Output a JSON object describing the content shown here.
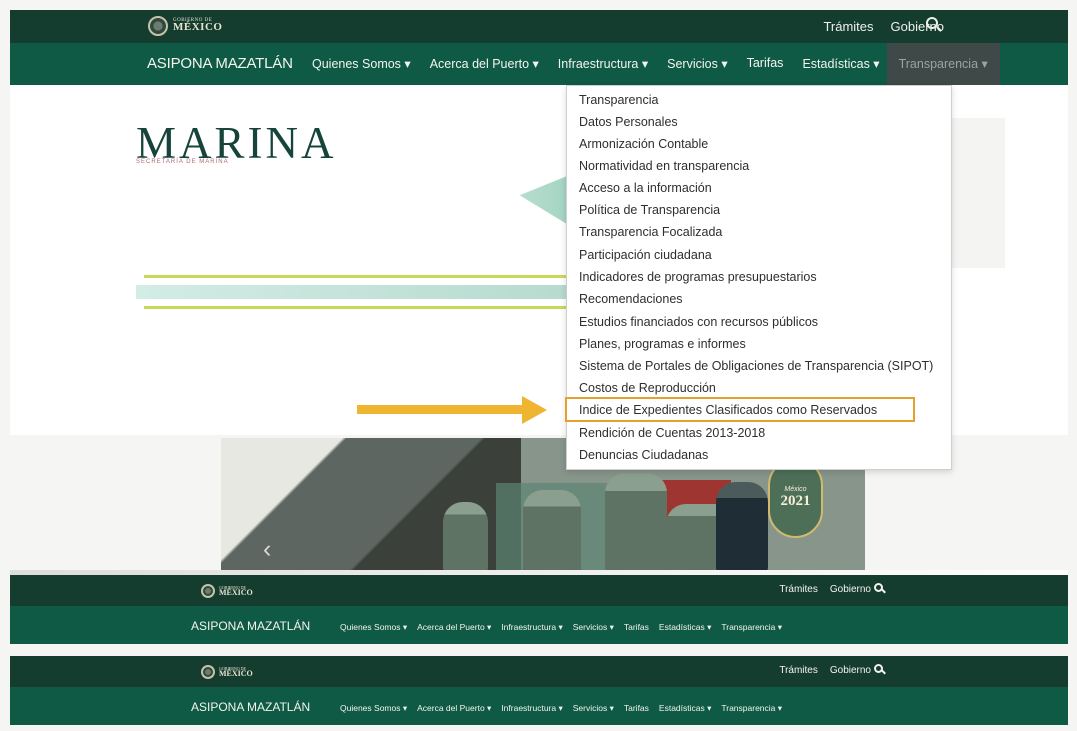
{
  "header": {
    "gov_small": "GOBIERNO DE",
    "gov_big": "MÉXICO",
    "links": [
      "Trámites",
      "Gobierno"
    ],
    "search_icon": "search-icon"
  },
  "nav": {
    "brand": "ASIPONA MAZATLÁN",
    "items": [
      "Quienes Somos ▾",
      "Acerca del Puerto ▾",
      "Infraestructura ▾",
      "Servicios ▾",
      "Tarifas",
      "Estadísticas ▾",
      "Transparencia ▾"
    ]
  },
  "hero": {
    "marina_title": "MARINA",
    "marina_subtitle": "SECRETARÍA DE MARINA"
  },
  "dropdown": {
    "items": [
      "Transparencia",
      "Datos Personales",
      "Armonización Contable",
      "Normatividad en transparencia",
      "Acceso a la información",
      "Política de Transparencia",
      "Transparencia Focalizada",
      "Participación ciudadana",
      "Indicadores de programas presupuestarios",
      "Recomendaciones",
      "Estudios financiados con recursos públicos",
      "Planes, programas e informes",
      "Sistema de Portales de Obligaciones de Transparencia (SIPOT)",
      "Costos de Reproducción",
      "Indice de Expedientes Clasificados como Reservados",
      "Rendición de Cuentas 2013-2018",
      "Denuncias Ciudadanas"
    ],
    "highlighted_index": 14
  },
  "photo": {
    "badge_small": "México",
    "badge_year": "2021"
  },
  "repeated_bars": {
    "brand": "ASIPONA MAZATLÁN",
    "links": [
      "Trámites",
      "Gobierno"
    ],
    "menu": [
      "Quienes Somos ▾",
      "Acerca del Puerto ▾",
      "Infraestructura ▾",
      "Servicios ▾",
      "Tarifas",
      "Estadísticas ▾",
      "Transparencia ▾"
    ]
  },
  "colors": {
    "dark_green": "#143d30",
    "nav_green": "#0f5a44",
    "highlight_orange": "#e4a12e"
  }
}
